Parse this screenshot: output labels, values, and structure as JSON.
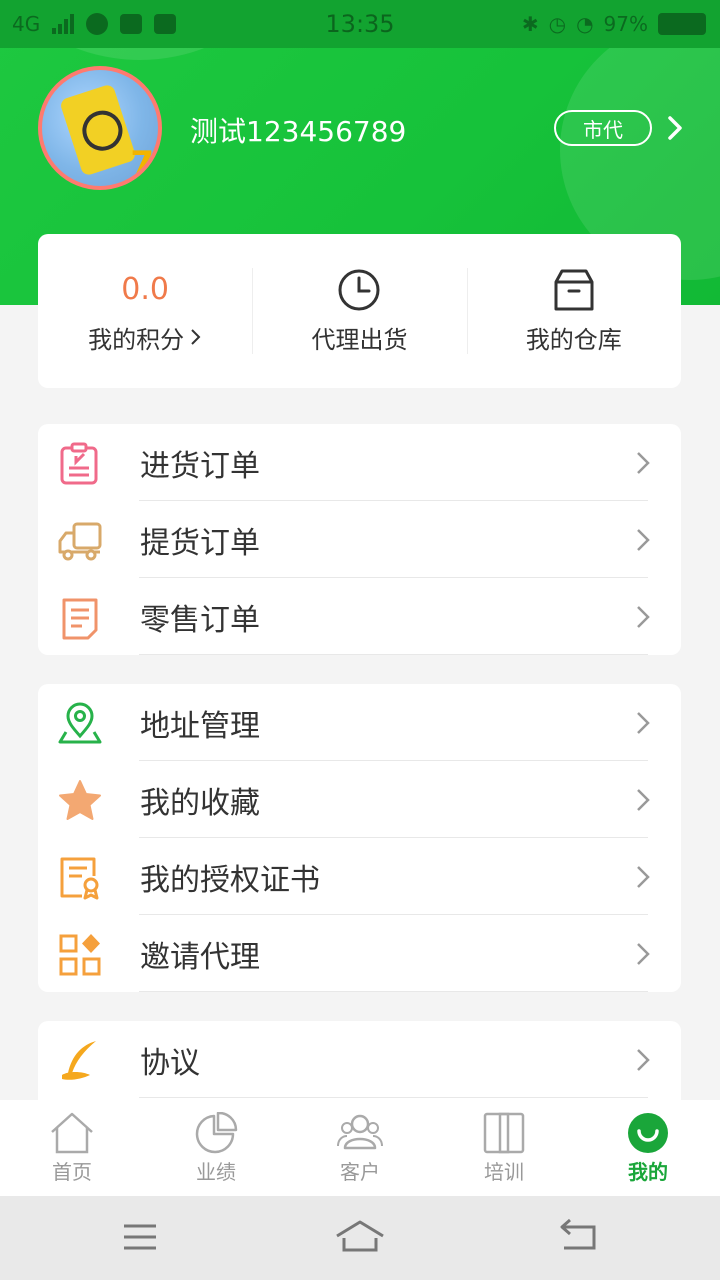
{
  "status_bar": {
    "network": "4G",
    "time": "13:35",
    "battery": "97%"
  },
  "profile": {
    "username": "测试123456789",
    "role": "市代"
  },
  "quick": {
    "points_value": "0.0",
    "points_label": "我的积分",
    "ship_label": "代理出货",
    "warehouse_label": "我的仓库"
  },
  "orders": [
    {
      "label": "进货订单",
      "icon": "purchase-order-icon",
      "color": "#f06a8a"
    },
    {
      "label": "提货订单",
      "icon": "truck-icon",
      "color": "#d8a96a"
    },
    {
      "label": "零售订单",
      "icon": "receipt-icon",
      "color": "#f0936a"
    }
  ],
  "services": [
    {
      "label": "地址管理",
      "icon": "location-pin-icon",
      "color": "#27b24a"
    },
    {
      "label": "我的收藏",
      "icon": "star-icon",
      "color": "#f3a872"
    },
    {
      "label": "我的授权证书",
      "icon": "certificate-icon",
      "color": "#f5a03c"
    },
    {
      "label": "邀请代理",
      "icon": "grid-apps-icon",
      "color": "#f5a03c"
    }
  ],
  "others": [
    {
      "label": "协议",
      "icon": "feather-pen-icon",
      "color": "#f5a81e"
    }
  ],
  "tabbar": {
    "tabs": [
      {
        "label": "首页",
        "icon": "home-icon"
      },
      {
        "label": "业绩",
        "icon": "pie-chart-icon"
      },
      {
        "label": "客户",
        "icon": "customers-icon"
      },
      {
        "label": "培训",
        "icon": "book-icon"
      },
      {
        "label": "我的",
        "icon": "profile-smile-icon"
      }
    ],
    "active": "我的",
    "active_color": "#1aa63a"
  },
  "colors": {
    "header_green": "#16c23a",
    "points_orange": "#f07a4a"
  }
}
